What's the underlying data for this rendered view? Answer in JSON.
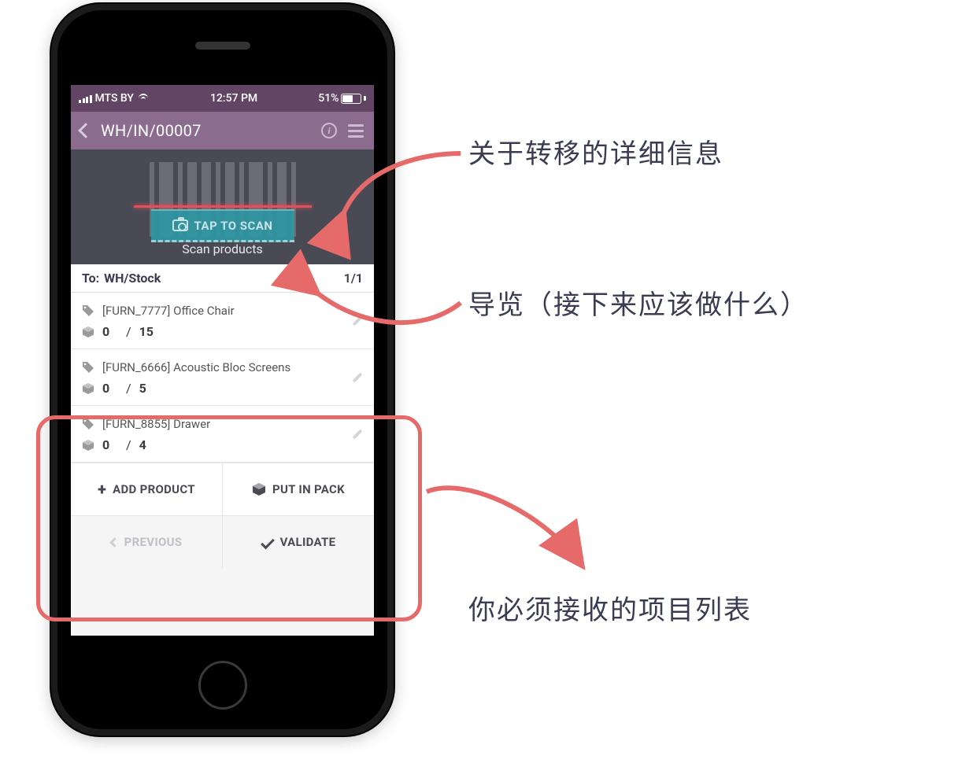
{
  "status": {
    "carrier": "MTS BY",
    "time": "12:57 PM",
    "battery": "51%"
  },
  "nav": {
    "title": "WH/IN/00007"
  },
  "scan": {
    "button": "TAP TO SCAN",
    "hint": "Scan products"
  },
  "destination": {
    "label": "To:",
    "value": "WH/Stock",
    "page": "1/1"
  },
  "products": [
    {
      "name": "[FURN_7777] Office Chair",
      "done": "0",
      "sep": "/",
      "total": "15"
    },
    {
      "name": "[FURN_6666] Acoustic Bloc Screens",
      "done": "0",
      "sep": "/",
      "total": "5"
    },
    {
      "name": "[FURN_8855] Drawer",
      "done": "0",
      "sep": "/",
      "total": "4"
    }
  ],
  "buttons": {
    "add": "ADD PRODUCT",
    "pack": "PUT IN PACK",
    "prev": "PREVIOUS",
    "validate": "VALIDATE"
  },
  "annotations": {
    "a1": "关于转移的详细信息",
    "a2": "导览（接下来应该做什么）",
    "a3": "你必须接收的项目列表"
  }
}
